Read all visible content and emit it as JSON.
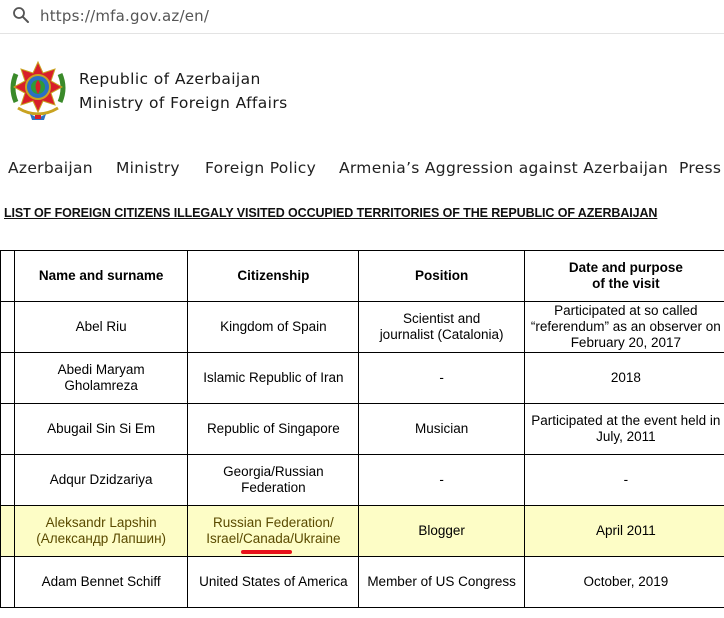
{
  "browser": {
    "url": "https://mfa.gov.az/en/"
  },
  "header": {
    "org_line1": "Republic of Azerbaijan",
    "org_line2": "Ministry of Foreign Affairs",
    "emblem_icon": "azerbaijan-emblem-icon"
  },
  "nav": {
    "items": [
      "Azerbaijan",
      "Ministry",
      "Foreign Policy",
      "Armenia’s Aggression against Azerbaijan",
      "Press"
    ]
  },
  "list_title": "LIST OF FOREIGN CITIZENS ILLEGALY VISITED OCCUPIED TERRITORIES OF THE REPUBLIC OF AZERBAIJAN",
  "table": {
    "headers": [
      "Name and surname",
      "Citizenship",
      "Position",
      "Date and purpose of the visit"
    ],
    "rows": [
      {
        "name": "Abel Riu",
        "citizenship": "Kingdom of Spain",
        "position": "Scientist and journalist (Catalonia)",
        "visit": "Participated at so called “referendum” as an observer on February 20, 2017"
      },
      {
        "name": "Abedi Maryam Gholamreza",
        "citizenship": "Islamic Republic of Iran",
        "position": "-",
        "visit": "2018"
      },
      {
        "name": "Abugail Sin Si Em",
        "citizenship": "Republic of Singapore",
        "position": "Musician",
        "visit": "Participated at the event held in July, 2011"
      },
      {
        "name": "Adqur Dzidzariya",
        "citizenship": "Georgia/Russian Federation",
        "position": "-",
        "visit": "-"
      },
      {
        "name_line1": "Aleksandr Lapshin",
        "name_line2": "(Александр Лапшин)",
        "citizenship_line1": "Russian Federation/",
        "citizenship_pre": "Israel/",
        "citizenship_highlight": "Canada",
        "citizenship_post": "/Ukraine",
        "position": "Blogger",
        "visit": "April 2011"
      },
      {
        "name": "Adam Bennet Schiff",
        "citizenship": "United States of America",
        "position": "Member of US Congress",
        "visit": "October, 2019"
      }
    ]
  },
  "colors": {
    "highlight_row": "#fdfdc6",
    "underline_mark": "#e8121a"
  }
}
